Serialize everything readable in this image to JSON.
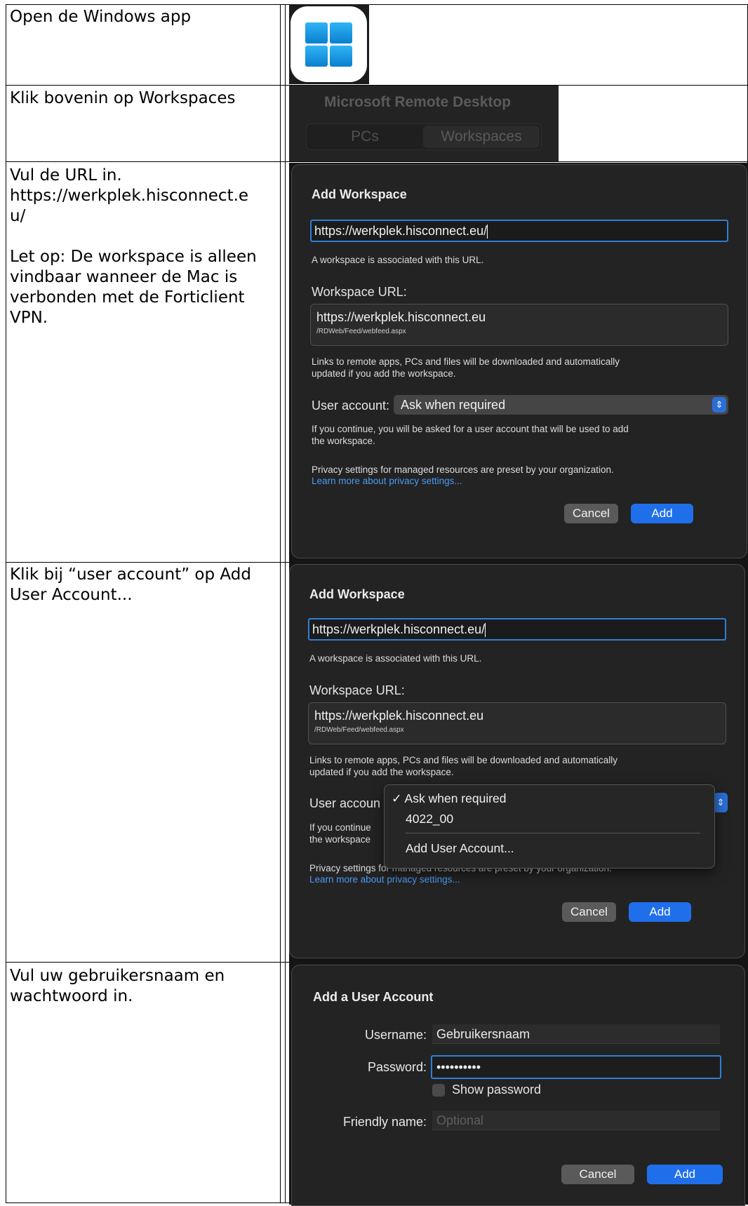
{
  "steps": [
    {
      "instruction": [
        "Open de Windows app"
      ]
    },
    {
      "instruction": [
        "Klik bovenin op Workspaces"
      ]
    },
    {
      "instruction": [
        "Vul de URL in.",
        "https://werkplek.hisconnect.e",
        "u/",
        "",
        "Let op: De workspace is alleen",
        "vindbaar wanneer de Mac is",
        "verbonden met de Forticlient",
        "VPN."
      ]
    },
    {
      "instruction": [
        "Klik bij “user account” op Add",
        "User Account..."
      ]
    },
    {
      "instruction": [
        "Vul uw gebruikersnaam en",
        "wachtwoord in."
      ]
    }
  ],
  "rdp_header": {
    "title": "Microsoft Remote Desktop",
    "tab_pcs": "PCs",
    "tab_workspaces": "Workspaces"
  },
  "add_workspace": {
    "title": "Add Workspace",
    "url_value": "https://werkplek.hisconnect.eu/",
    "associated_text": "A workspace is associated with this URL.",
    "workspace_url_label": "Workspace URL:",
    "workspace_url_main": "https://werkplek.hisconnect.eu",
    "workspace_url_path": "/RDWeb/Feed/webfeed.aspx",
    "links_text_1": "Links to remote apps, PCs and files will be downloaded and automatically",
    "links_text_2": "updated if you add the workspace.",
    "user_account_label": "User account:",
    "user_account_value": "Ask when required",
    "continue_text_1": "If you continue, you will be asked for a user account that will be used to add",
    "continue_text_2": "the workspace.",
    "privacy_text": "Privacy settings for managed resources are preset by your organization.",
    "privacy_link": "Learn more about privacy settings...",
    "cancel_label": "Cancel",
    "add_label": "Add"
  },
  "add_workspace_menu": {
    "user_account_label_cut": "User accoun",
    "continue_cut_1": "If you continue",
    "continue_cut_2": "the workspace",
    "privacy_text_partial": "Privacy settings for managed resources are preset by your organization.",
    "items": [
      "✓ Ask when required",
      "4022_00",
      "Add User Account..."
    ]
  },
  "add_user_account": {
    "title": "Add a User Account",
    "username_label": "Username:",
    "username_value": "Gebruikersnaam",
    "password_label": "Password:",
    "password_value": "••••••••••",
    "show_password_label": "Show password",
    "friendly_name_label": "Friendly name:",
    "friendly_name_placeholder": "Optional",
    "cancel_label": "Cancel",
    "add_label": "Add"
  },
  "colors": {
    "dialog_bg": "#232323",
    "accent_blue": "#1f6feb",
    "link_blue": "#4a9af3",
    "windows_blue": "#1a9be8"
  },
  "icons": {
    "windows_app": "windows-app-icon",
    "checkbox": "checkbox-icon",
    "select_chevron": "updown-chevron-icon"
  }
}
